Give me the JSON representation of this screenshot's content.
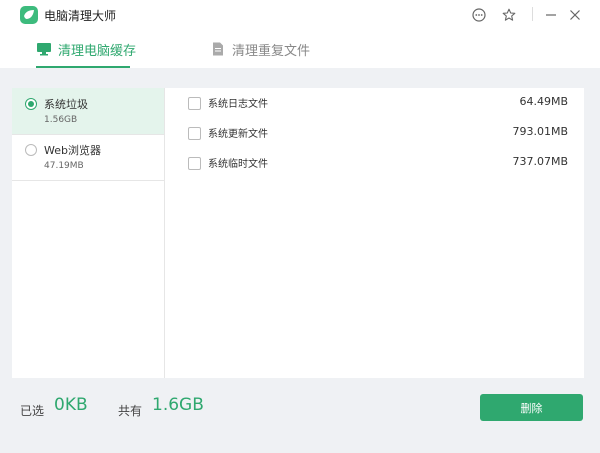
{
  "app": {
    "title": "电脑清理大师"
  },
  "tabs": [
    {
      "label": "清理电脑缓存",
      "active": true
    },
    {
      "label": "清理重复文件",
      "active": false
    }
  ],
  "sidebar": {
    "items": [
      {
        "name": "系统垃圾",
        "size": "1.56GB",
        "selected": true
      },
      {
        "name": "Web浏览器",
        "size": "47.19MB",
        "selected": false
      }
    ]
  },
  "files": [
    {
      "name": "系统日志文件",
      "size": "64.49MB"
    },
    {
      "name": "系统更新文件",
      "size": "793.01MB"
    },
    {
      "name": "系统临时文件",
      "size": "737.07MB"
    }
  ],
  "footer": {
    "selected_label": "已选",
    "selected_value": "0KB",
    "total_label": "共有",
    "total_value": "1.6GB",
    "delete_label": "删除"
  },
  "icons": {
    "menu": "more-icon",
    "skin": "star-icon",
    "minimize": "minimize-icon",
    "close": "close-icon"
  },
  "colors": {
    "accent": "#2fa86f",
    "selected_bg": "#e4f4ec",
    "content_bg": "#eff1f4"
  }
}
